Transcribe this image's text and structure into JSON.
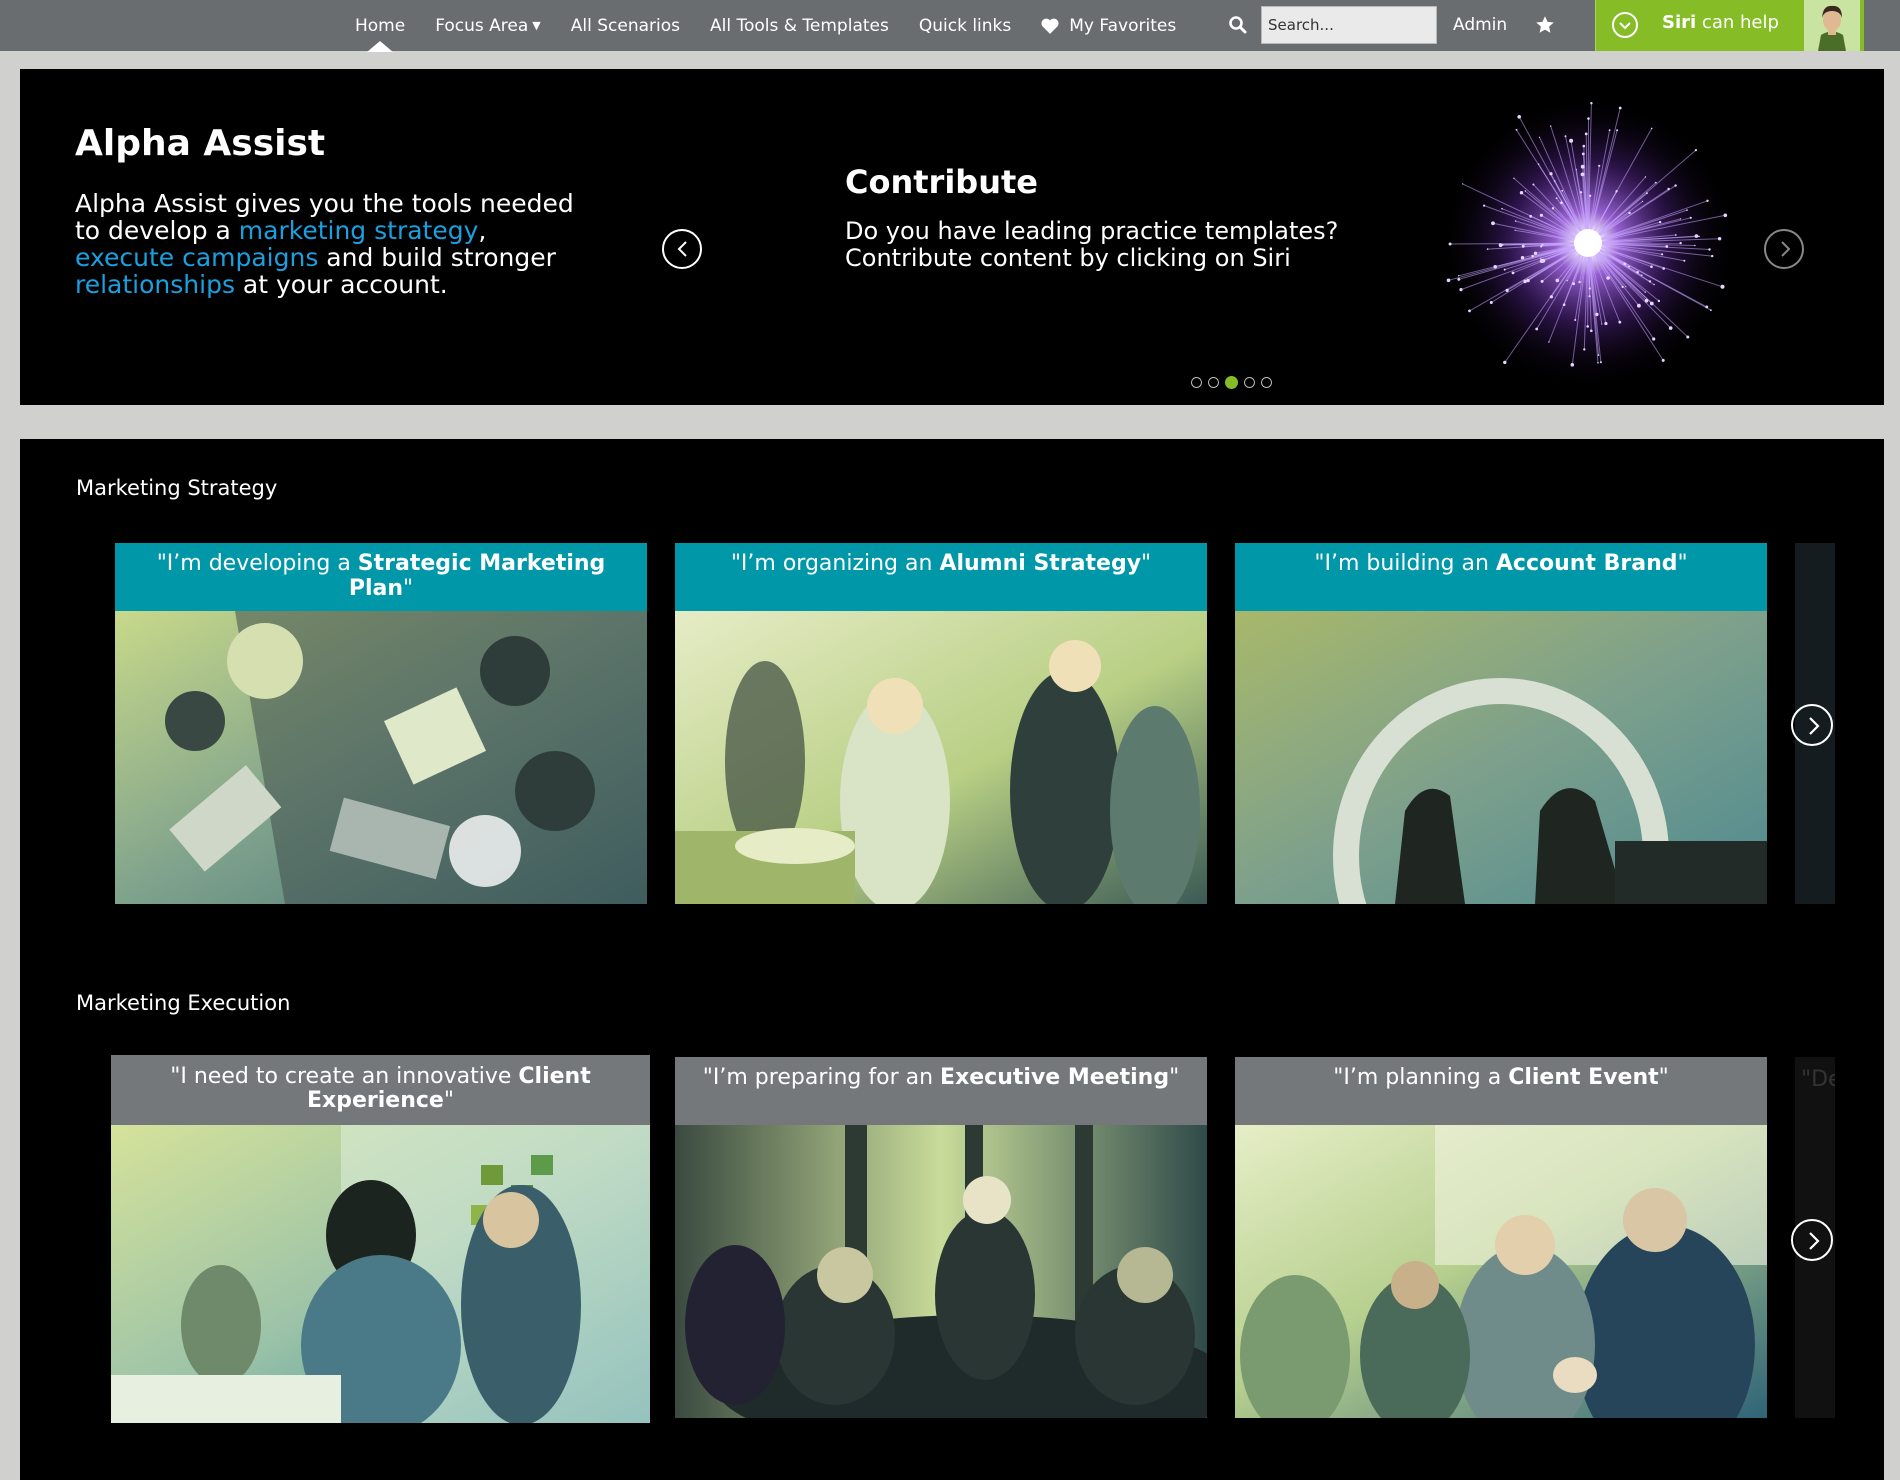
{
  "nav": {
    "items": [
      {
        "label": "Home",
        "active": true
      },
      {
        "label": "Focus Area",
        "has_dropdown": true
      },
      {
        "label": "All Scenarios"
      },
      {
        "label": "All Tools & Templates"
      },
      {
        "label": "Quick links"
      },
      {
        "label": "My Favorites",
        "icon": "heart-icon"
      }
    ],
    "search_placeholder": "Search...",
    "admin_label": "Admin",
    "siri": {
      "name": "Siri",
      "suffix": "can help"
    }
  },
  "hero": {
    "title": "Alpha Assist",
    "body_pre": "Alpha Assist gives you the tools needed to develop a ",
    "link1": "marketing strategy",
    "sep1": ",",
    "link2": "execute campaigns",
    "mid": " and build stronger ",
    "link3": "relationships",
    "end": " at your account.",
    "slide": {
      "title": "Contribute",
      "body": "Do you have leading practice templates? Contribute content by clicking on Siri"
    },
    "dots": {
      "count": 5,
      "active_index": 2
    }
  },
  "sections": [
    {
      "title": "Marketing Strategy",
      "cards": [
        {
          "pre": "\"I’m developing a ",
          "bold": "Strategic Marketing Plan",
          "post": "\""
        },
        {
          "pre": "\"I’m organizing an ",
          "bold": "Alumni Strategy",
          "post": "\""
        },
        {
          "pre": "\"I’m building an ",
          "bold": "Account Brand",
          "post": "\""
        }
      ]
    },
    {
      "title": "Marketing Execution",
      "cards": [
        {
          "pre": "\"I need to create an innovative ",
          "bold": "Client Experience",
          "post": "\""
        },
        {
          "pre": "\"I’m preparing for an ",
          "bold": "Executive Meeting",
          "post": "\""
        },
        {
          "pre": "\"I’m planning a ",
          "bold": "Client Event",
          "post": "\""
        }
      ],
      "peek_text": "\"De"
    }
  ],
  "colors": {
    "nav_bg": "#6a6d70",
    "accent_green": "#86bc25",
    "teal": "#0097a9",
    "card_gray": "#75787b",
    "link_blue": "#1aa0e0"
  }
}
